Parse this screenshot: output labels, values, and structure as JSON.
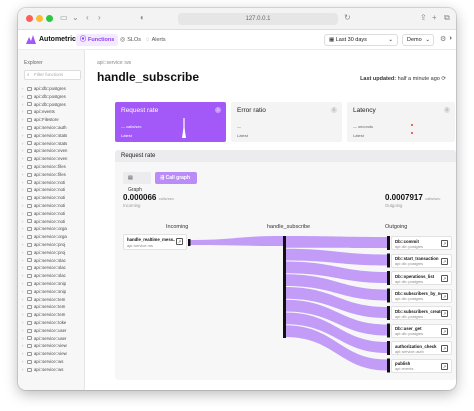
{
  "browser": {
    "url": "127.0.0.1"
  },
  "header": {
    "brand": "Autometrics",
    "tabs": [
      {
        "label": "Functions",
        "icon": "functions-icon",
        "active": true
      },
      {
        "label": "SLOs",
        "icon": "target-icon",
        "active": false
      },
      {
        "label": "Alerts",
        "icon": "bell-icon",
        "active": false
      }
    ],
    "time_range": "Last 30 days",
    "workspace": "Demo"
  },
  "sidebar": {
    "title": "Explorer",
    "search_placeholder": "Filter functions",
    "items": [
      "api::db::postgres",
      "api::db::postgres",
      "api::db::postgres",
      "api::events",
      "api::Filestore",
      "api::service::auth",
      "api::service::stats",
      "api::service::stats",
      "api::service::even",
      "api::service::even",
      "api::service::files",
      "api::service::files",
      "api::service::noti",
      "api::service::noti",
      "api::service::noti",
      "api::service::noti",
      "api::service::noti",
      "api::service::noti",
      "api::service::orga",
      "api::service::orga",
      "api::service::proj",
      "api::service::proj",
      "api::service::slac",
      "api::service::slac",
      "api::service::slac",
      "api::service::snip",
      "api::service::snip",
      "api::service::tem",
      "api::service::tem",
      "api::service::tem",
      "api::service::toke",
      "api::service::user",
      "api::service::user",
      "api::service::view",
      "api::service::view",
      "api::service::ws",
      "api::service::ws"
    ]
  },
  "main": {
    "module": "api::service::ws",
    "function": "handle_subscribe",
    "last_updated_label": "Last updated:",
    "last_updated_value": "half a minute ago",
    "cards": {
      "request_rate": {
        "title": "Request rate",
        "legend": "calls/sec",
        "latest": "Latest"
      },
      "error_ratio": {
        "title": "Error ratio",
        "legend": "—",
        "latest": "Latest"
      },
      "latency": {
        "title": "Latency",
        "legend": "seconds",
        "latest": "Latest"
      }
    },
    "panel": {
      "title": "Request rate",
      "view_graph": "Graph",
      "view_call_graph": "Call graph",
      "incoming_value": "0.000066",
      "incoming_unit": "calls/sec",
      "incoming_label": "Incoming",
      "outgoing_value": "0.0007917",
      "outgoing_unit": "calls/sec",
      "outgoing_label": "Outgoing",
      "col_incoming": "Incoming",
      "col_center": "handle_subscribe",
      "col_outgoing": "Outgoing"
    },
    "incoming_nodes": [
      {
        "name": "handle_realtime_mess...",
        "module": "api::service::ws"
      }
    ],
    "outgoing_nodes": [
      {
        "name": "Db::commit",
        "module": "api::db::postgres"
      },
      {
        "name": "Db::start_transaction",
        "module": "api::db::postgres"
      },
      {
        "name": "Db::operations_list",
        "module": "api::db::postgres"
      },
      {
        "name": "Db::subscribers_by_no...",
        "module": "api::db::postgres"
      },
      {
        "name": "Db::subscribers_create",
        "module": "api::db::postgres"
      },
      {
        "name": "Db::user_get",
        "module": "api::db::postgres"
      },
      {
        "name": "authorization_check",
        "module": "api::service::auth"
      },
      {
        "name": "publish",
        "module": "api::events"
      }
    ]
  },
  "colors": {
    "accent": "#a259f7",
    "flow": "#b98cf7",
    "node_bar": "#111111"
  }
}
